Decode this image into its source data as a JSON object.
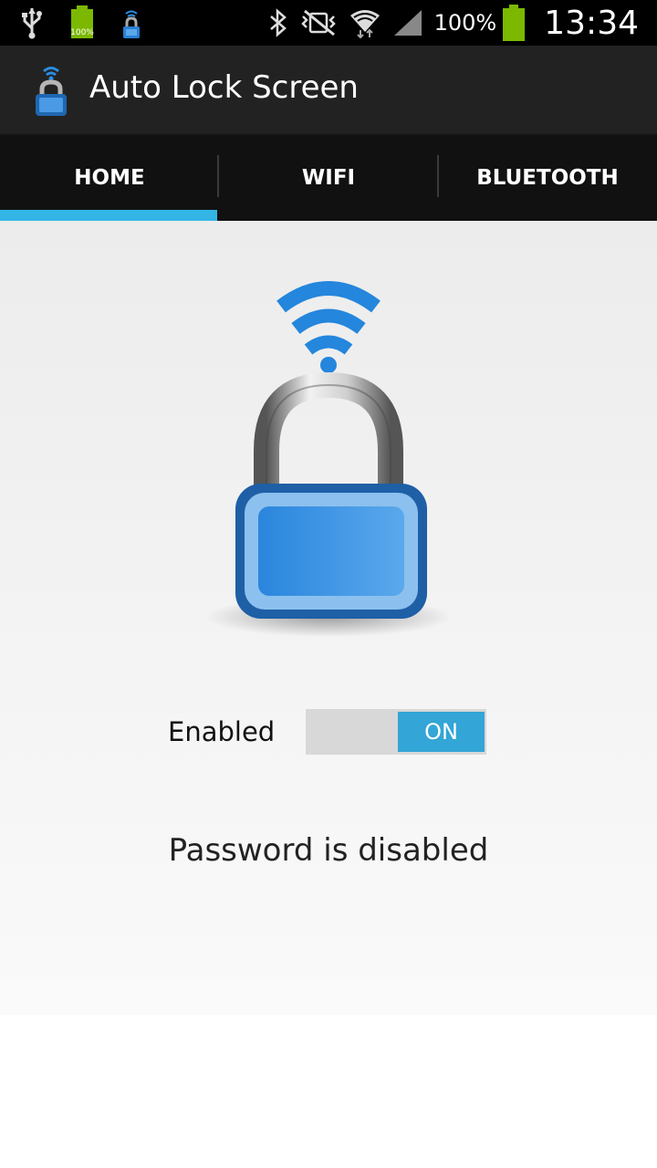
{
  "status_bar": {
    "battery_small_label": "100%",
    "battery_percent": "100%",
    "time": "13:34"
  },
  "action_bar": {
    "title": "Auto Lock Screen"
  },
  "tabs": [
    {
      "label": "HOME",
      "selected": true
    },
    {
      "label": "WIFI",
      "selected": false
    },
    {
      "label": "BLUETOOTH",
      "selected": false
    }
  ],
  "main": {
    "enabled_label": "Enabled",
    "switch_state": "ON",
    "password_status": "Password is disabled"
  },
  "colors": {
    "accent": "#33b5e5",
    "switch_on": "#33a5d6",
    "lock_blue": "#2a7fd4",
    "battery_green": "#7cb800"
  }
}
